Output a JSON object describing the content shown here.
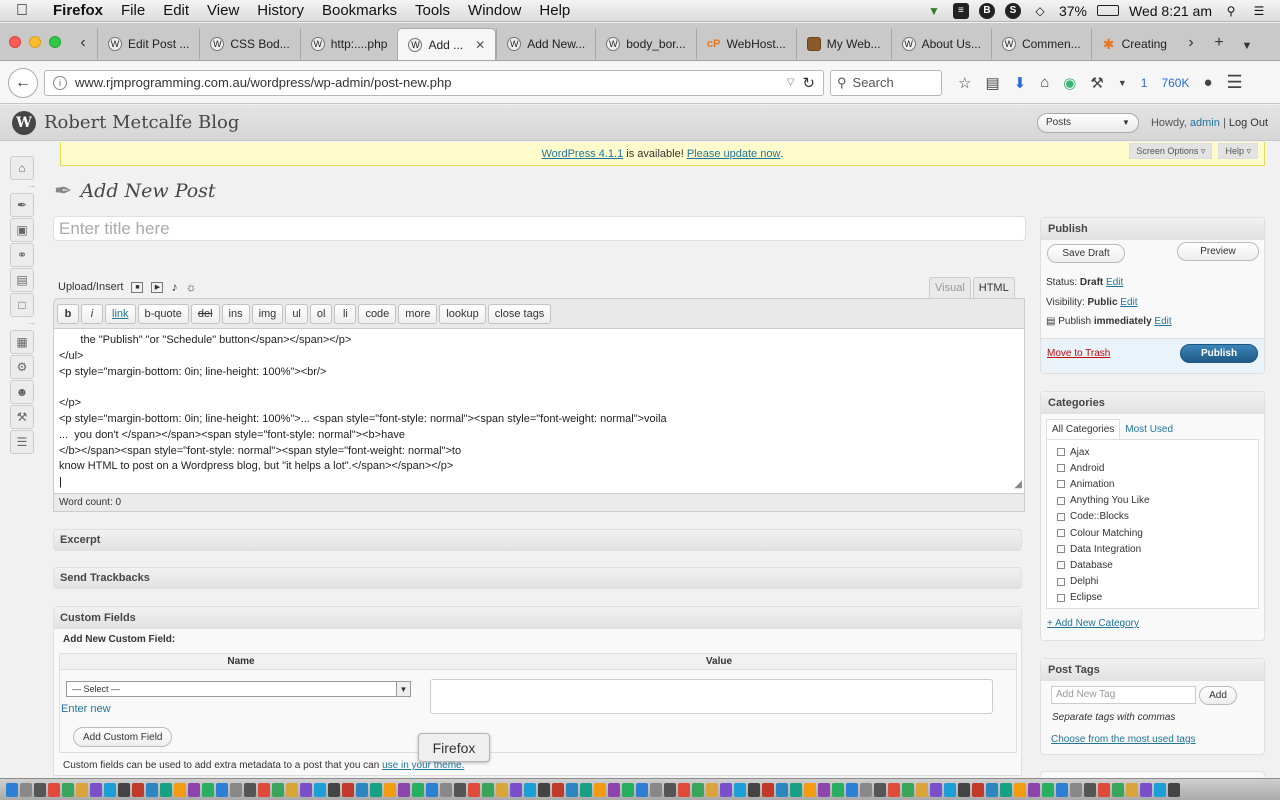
{
  "menubar": {
    "app": "Firefox",
    "menus": [
      "File",
      "Edit",
      "View",
      "History",
      "Bookmarks",
      "Tools",
      "Window",
      "Help"
    ],
    "battery": "37%",
    "clock": "Wed 8:21 am"
  },
  "tabs": [
    {
      "label": "Edit Post ..."
    },
    {
      "label": "CSS Bod..."
    },
    {
      "label": "http:....php"
    },
    {
      "label": "Add ...",
      "active": true
    },
    {
      "label": "Add New..."
    },
    {
      "label": "body_bor..."
    },
    {
      "label": "WebHost..."
    },
    {
      "label": "My Web..."
    },
    {
      "label": "About Us..."
    },
    {
      "label": "Commen..."
    },
    {
      "label": "Creating"
    }
  ],
  "nav": {
    "url": "www.rjmprogramming.com.au/wordpress/wp-admin/post-new.php",
    "search_placeholder": "Search",
    "badge_count": "1",
    "badge_size": "760K"
  },
  "wp": {
    "site_title": "Robert Metcalfe Blog",
    "favorite_select": "Posts",
    "howdy_prefix": "Howdy,",
    "user": "admin",
    "logout": "Log Out",
    "nag_version": "WordPress 4.1.1",
    "nag_middle": "is available!",
    "nag_link": "Please update now",
    "screen_options": "Screen Options",
    "help": "Help"
  },
  "editor": {
    "page_title": "Add New Post",
    "title_placeholder": "Enter title here",
    "upload_label": "Upload/Insert",
    "tab_visual": "Visual",
    "tab_html": "HTML",
    "quicktags": [
      "b",
      "i",
      "link",
      "b-quote",
      "del",
      "ins",
      "img",
      "ul",
      "ol",
      "li",
      "code",
      "more",
      "lookup",
      "close tags"
    ],
    "content_lines": [
      "       the \"Publish\" \"or \"Schedule\" button</span></span></p>",
      "</ul>",
      "<p style=\"margin-bottom: 0in; line-height: 100%\"><br/>",
      "",
      "</p>",
      "<p style=\"margin-bottom: 0in; line-height: 100%\">... <span style=\"font-style: normal\"><span style=\"font-weight: normal\">voila",
      "...  you don't </span></span><span style=\"font-style: normal\"><b>have",
      "</b></span><span style=\"font-style: normal\"><span style=\"font-weight: normal\">to",
      "know HTML to post on a Wordpress blog, but \"it helps a lot\".</span></span></p>",
      "|"
    ],
    "word_count": "Word count: 0"
  },
  "boxes": {
    "excerpt": "Excerpt",
    "trackbacks": "Send Trackbacks",
    "custom_fields": "Custom Fields",
    "cf_sub": "Add New Custom Field:",
    "cf_name": "Name",
    "cf_value": "Value",
    "cf_select": "— Select —",
    "cf_enter_new": "Enter new",
    "cf_add_button": "Add Custom Field",
    "cf_note": "Custom fields can be used to add extra metadata to a post that you can",
    "cf_note_link": "use in your theme."
  },
  "publish": {
    "title": "Publish",
    "save_draft": "Save Draft",
    "preview": "Preview",
    "status_label": "Status:",
    "status_value": "Draft",
    "visibility_label": "Visibility:",
    "visibility_value": "Public",
    "publish_label": "Publish",
    "publish_value": "immediately",
    "edit": "Edit",
    "trash": "Move to Trash",
    "publish_button": "Publish"
  },
  "categories": {
    "title": "Categories",
    "tab_all": "All Categories",
    "tab_most": "Most Used",
    "items": [
      "Ajax",
      "Android",
      "Animation",
      "Anything You Like",
      "Code::Blocks",
      "Colour Matching",
      "Data Integration",
      "Database",
      "Delphi",
      "Eclipse"
    ],
    "add_new": "+ Add New Category"
  },
  "tags": {
    "title": "Post Tags",
    "placeholder": "Add New Tag",
    "add_button": "Add",
    "hint": "Separate tags with commas",
    "choose": "Choose from the most used tags"
  },
  "tooltip": "Firefox",
  "colors": {
    "wp_link": "#21759b",
    "publish_button": "#2a6496",
    "nag_bg": "#fffbcc",
    "trash": "#bc0b0b"
  }
}
